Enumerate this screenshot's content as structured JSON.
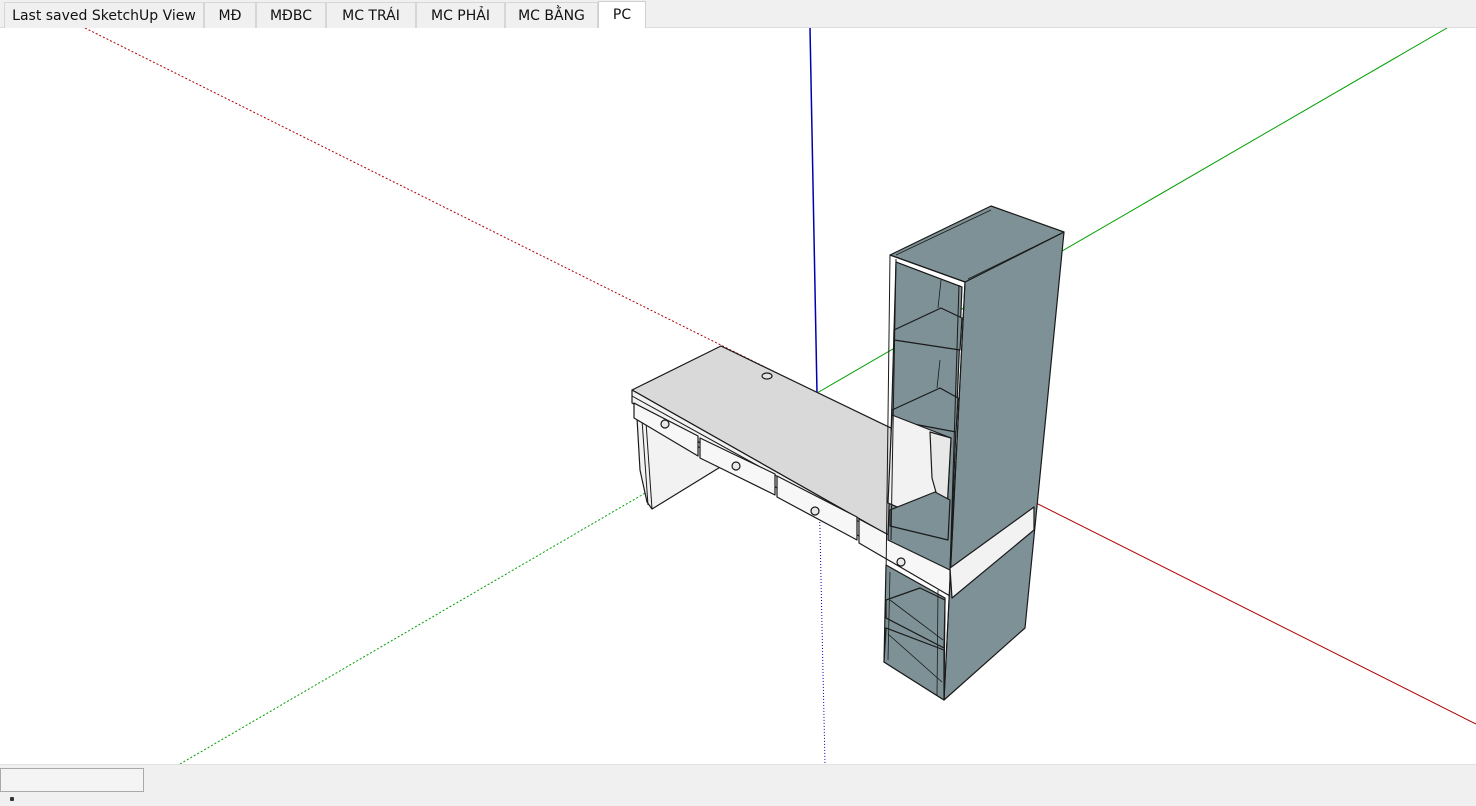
{
  "tabs": [
    {
      "label": "Last saved SketchUp View",
      "active": false
    },
    {
      "label": "MĐ",
      "active": false
    },
    {
      "label": "MĐBC",
      "active": false
    },
    {
      "label": "MC TRÁI",
      "active": false
    },
    {
      "label": "MC PHẢI",
      "active": false
    },
    {
      "label": "MC BẰNG",
      "active": false
    },
    {
      "label": "PC",
      "active": true
    }
  ],
  "colors": {
    "red_axis": "#b00000",
    "green_axis": "#00a000",
    "blue_axis": "#0000b0",
    "cabinet_gray": "#7e9196",
    "desk_top": "#d9d9d9",
    "desk_front": "#f2f2f2",
    "edge": "#1a1a1a"
  },
  "status": {
    "measurements_value": ""
  }
}
